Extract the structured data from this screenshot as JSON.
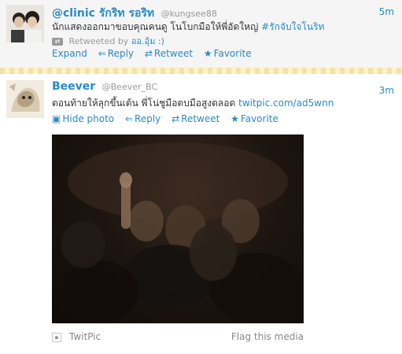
{
  "tweets": [
    {
      "name": "@clinic รักริท รอริท",
      "handle": "@kungsee88",
      "time": "5m",
      "text": "นักแสดงออกมาขอบคุณคนดู โนโบกมือให้พี่อัดใหญ่",
      "hashtag": "#รักจับใจโนริท",
      "retweeted_by_label": "Retweeted by",
      "retweeted_by_user": "ออ.อุ้ม :)",
      "actions": [
        "Expand",
        "Reply",
        "Retweet",
        "Favorite"
      ]
    },
    {
      "name": "Beever",
      "handle": "@Beever_BC",
      "time": "3m",
      "text": "ตอนท้ายให้ลุกขึ้นเต้น พี่โน่ชูมือตบมือสูงตลอด",
      "link": "twitpic.com/ad5wnn",
      "actions": [
        "Hide photo",
        "Reply",
        "Retweet",
        "Favorite"
      ],
      "media": {
        "source": "TwitPic",
        "flag": "Flag this media"
      }
    }
  ],
  "icons": {
    "retweeted": "retweet-icon",
    "reply": "reply-arrow-icon",
    "retweet": "retweet-icon",
    "favorite": "star-icon",
    "hide_photo": "photo-icon",
    "twitpic": "twitpic-icon"
  },
  "colors": {
    "link": "#2a8bc5",
    "text": "#333333",
    "muted": "#999999",
    "retweet_bg": "#f5f5f5"
  }
}
